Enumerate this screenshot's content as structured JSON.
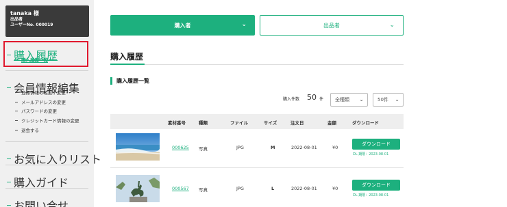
{
  "user": {
    "name": "tanaka 様",
    "role": "出品者",
    "user_no": "ユーザーNo. 000019"
  },
  "sidebar": {
    "purchase_history": "購入履歴",
    "purchase_history_list": "購入履歴一覧",
    "member_info": "会員情報編集",
    "member_items": [
      "登録情報の確認 / 変更",
      "メールアドレスの変更",
      "パスワードの変更",
      "クレジットカード情報の変更",
      "退会する"
    ],
    "favorites": "お気に入りリスト",
    "guide": "購入ガイド",
    "contact": "お問い合せ"
  },
  "tabs": {
    "buyer": "購入者",
    "seller": "出品者"
  },
  "page_title": "購入履歴",
  "section_title": "購入履歴一覧",
  "purchase_count": {
    "label": "購入件数",
    "value": "50",
    "unit": "件"
  },
  "filters": {
    "type": "全種類",
    "per_page": "50件"
  },
  "table": {
    "headers": [
      "素材番号",
      "種類",
      "ファイル",
      "サイズ",
      "注文日",
      "金額",
      "ダウンロード"
    ],
    "rows": [
      {
        "id": "000625",
        "kind": "写真",
        "file": "JPG",
        "size": "M",
        "date": "2022-08-01",
        "price": "¥0",
        "download": "ダウンロード",
        "limit": "DL 期限：2023-08-01"
      },
      {
        "id": "000567",
        "kind": "写真",
        "file": "JPG",
        "size": "L",
        "date": "2022-08-01",
        "price": "¥0",
        "download": "ダウンロード",
        "limit": "DL 期限：2023-08-01"
      }
    ]
  },
  "colors": {
    "accent": "#1db07e",
    "highlight": "#e0182d",
    "user_box": "#3a3a3a"
  }
}
